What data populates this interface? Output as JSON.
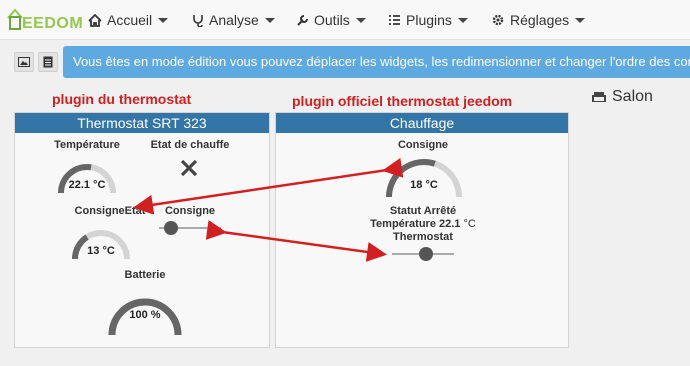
{
  "brand": {
    "text": "EEDOM",
    "color": "#94c84c"
  },
  "nav": [
    {
      "label": "Accueil",
      "icon": "home-icon"
    },
    {
      "label": "Analyse",
      "icon": "stethoscope-icon"
    },
    {
      "label": "Outils",
      "icon": "wrench-icon"
    },
    {
      "label": "Plugins",
      "icon": "list-icon"
    },
    {
      "label": "Réglages",
      "icon": "gears-icon"
    }
  ],
  "alert": {
    "text": "Vous êtes en mode édition vous pouvez déplacer les widgets, les redimensionner et changer l'ordre des con",
    "color": "#5ea9df"
  },
  "annotations": {
    "left": "plugin   du thermostat",
    "right": "plugin   officiel thermostat jeedom",
    "color": "#d31f1f"
  },
  "room": {
    "label": "Salon",
    "icon": "sofa-icon"
  },
  "card_left": {
    "title": "Thermostat SRT 323",
    "temperature": {
      "label": "Température",
      "value": "22.1 °C",
      "fraction": 0.55
    },
    "etat": {
      "label": "Etat de chauffe",
      "icon": "x-icon"
    },
    "consigne_etat": {
      "label": "ConsigneEtat",
      "value": "13 °C",
      "fraction": 0.32
    },
    "consigne": {
      "label": "Consigne",
      "fraction": 0.2
    },
    "batterie": {
      "label": "Batterie",
      "value": "100 %",
      "fraction": 1.0
    }
  },
  "card_right": {
    "title": "Chauffage",
    "consigne": {
      "label": "Consigne",
      "value": "18 °C",
      "fraction": 0.6
    },
    "statut": {
      "line1": "Statut Arrêté",
      "line2_label": "Température 22.1",
      "line2_unit": "°C",
      "line3": "Thermostat"
    },
    "slider": {
      "fraction": 0.55
    }
  },
  "colors": {
    "card_header": "#3475a8",
    "gauge_fill": "#666666",
    "gauge_track": "#d4d4d4"
  }
}
